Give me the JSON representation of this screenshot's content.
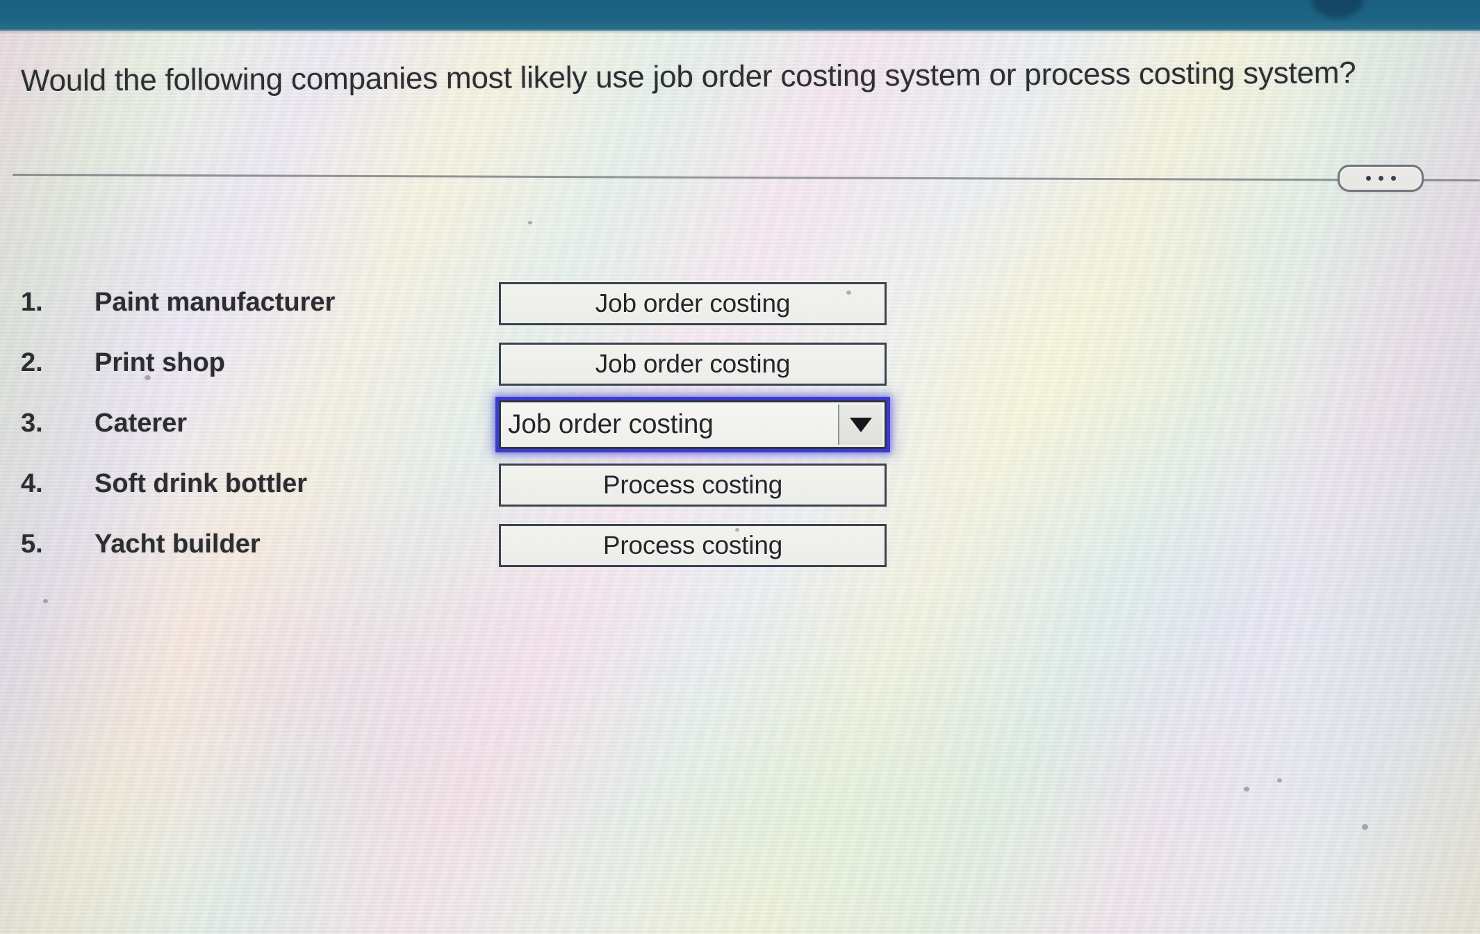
{
  "banner": {
    "color": "#1d6484"
  },
  "header": {
    "question": "Would the following companies most likely use job order costing system or process costing system?"
  },
  "toolbar": {
    "more_options_label": "…",
    "more_options_icon": "ellipsis-icon"
  },
  "main": {
    "rows": [
      {
        "number": "1.",
        "company": "Paint manufacturer",
        "answer": "Job order costing",
        "focused": false
      },
      {
        "number": "2.",
        "company": "Print shop",
        "answer": "Job order costing",
        "focused": false
      },
      {
        "number": "3.",
        "company": "Caterer",
        "answer": "Job order costing",
        "focused": true
      },
      {
        "number": "4.",
        "company": "Soft drink bottler",
        "answer": "Process costing",
        "focused": false
      },
      {
        "number": "5.",
        "company": "Yacht builder",
        "answer": "Process costing",
        "focused": false
      }
    ]
  },
  "select_options": [
    "Job order costing",
    "Process costing"
  ],
  "colors": {
    "banner_teal": "#1d6484",
    "focus_outline": "#3b3bd2",
    "box_border": "#3c4450",
    "text": "#23262b"
  }
}
